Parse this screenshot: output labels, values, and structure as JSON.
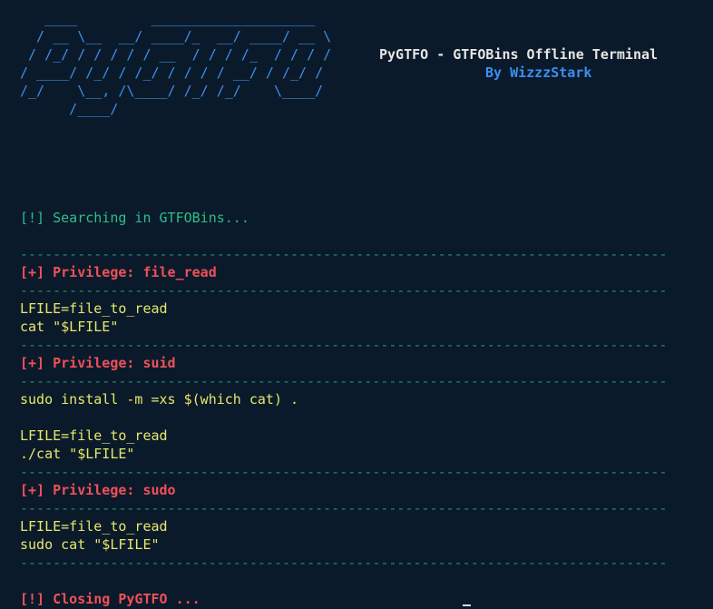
{
  "banner": {
    "ascii": "   ____         ____________________\n  / __ \\__  __/ ____/_  __/ ____/ __ \\\n / /_/ / / / / / __  / / / /_  / / / /\n/ ____/ /_/ / /_/ / / / / __/ / /_/ /\n/_/    \\__, /\\____/ /_/ /_/    \\____/\n      /____/",
    "title": "PyGTFO - GTFOBins Offline Terminal",
    "author": "By WizzzStark"
  },
  "colors": {
    "background": "#0b1a2a",
    "banner": "#3a8ff0",
    "info": "#2bbf8a",
    "privilege": "#f0505a",
    "command": "#e6e86a"
  },
  "output": {
    "searching": "[!] Searching in GTFOBins...",
    "separator": "--------------------------------------------------------------------------------",
    "sections": [
      {
        "header": "[+] Privilege: file_read",
        "blocks": [
          [
            "LFILE=file_to_read",
            "cat \"$LFILE\""
          ]
        ]
      },
      {
        "header": "[+] Privilege: suid",
        "blocks": [
          [
            "sudo install -m =xs $(which cat) ."
          ],
          [
            "LFILE=file_to_read",
            "./cat \"$LFILE\""
          ]
        ]
      },
      {
        "header": "[+] Privilege: sudo",
        "blocks": [
          [
            "LFILE=file_to_read",
            "sudo cat \"$LFILE\""
          ]
        ]
      }
    ],
    "closing": "[!] Closing PyGTFO ..."
  }
}
